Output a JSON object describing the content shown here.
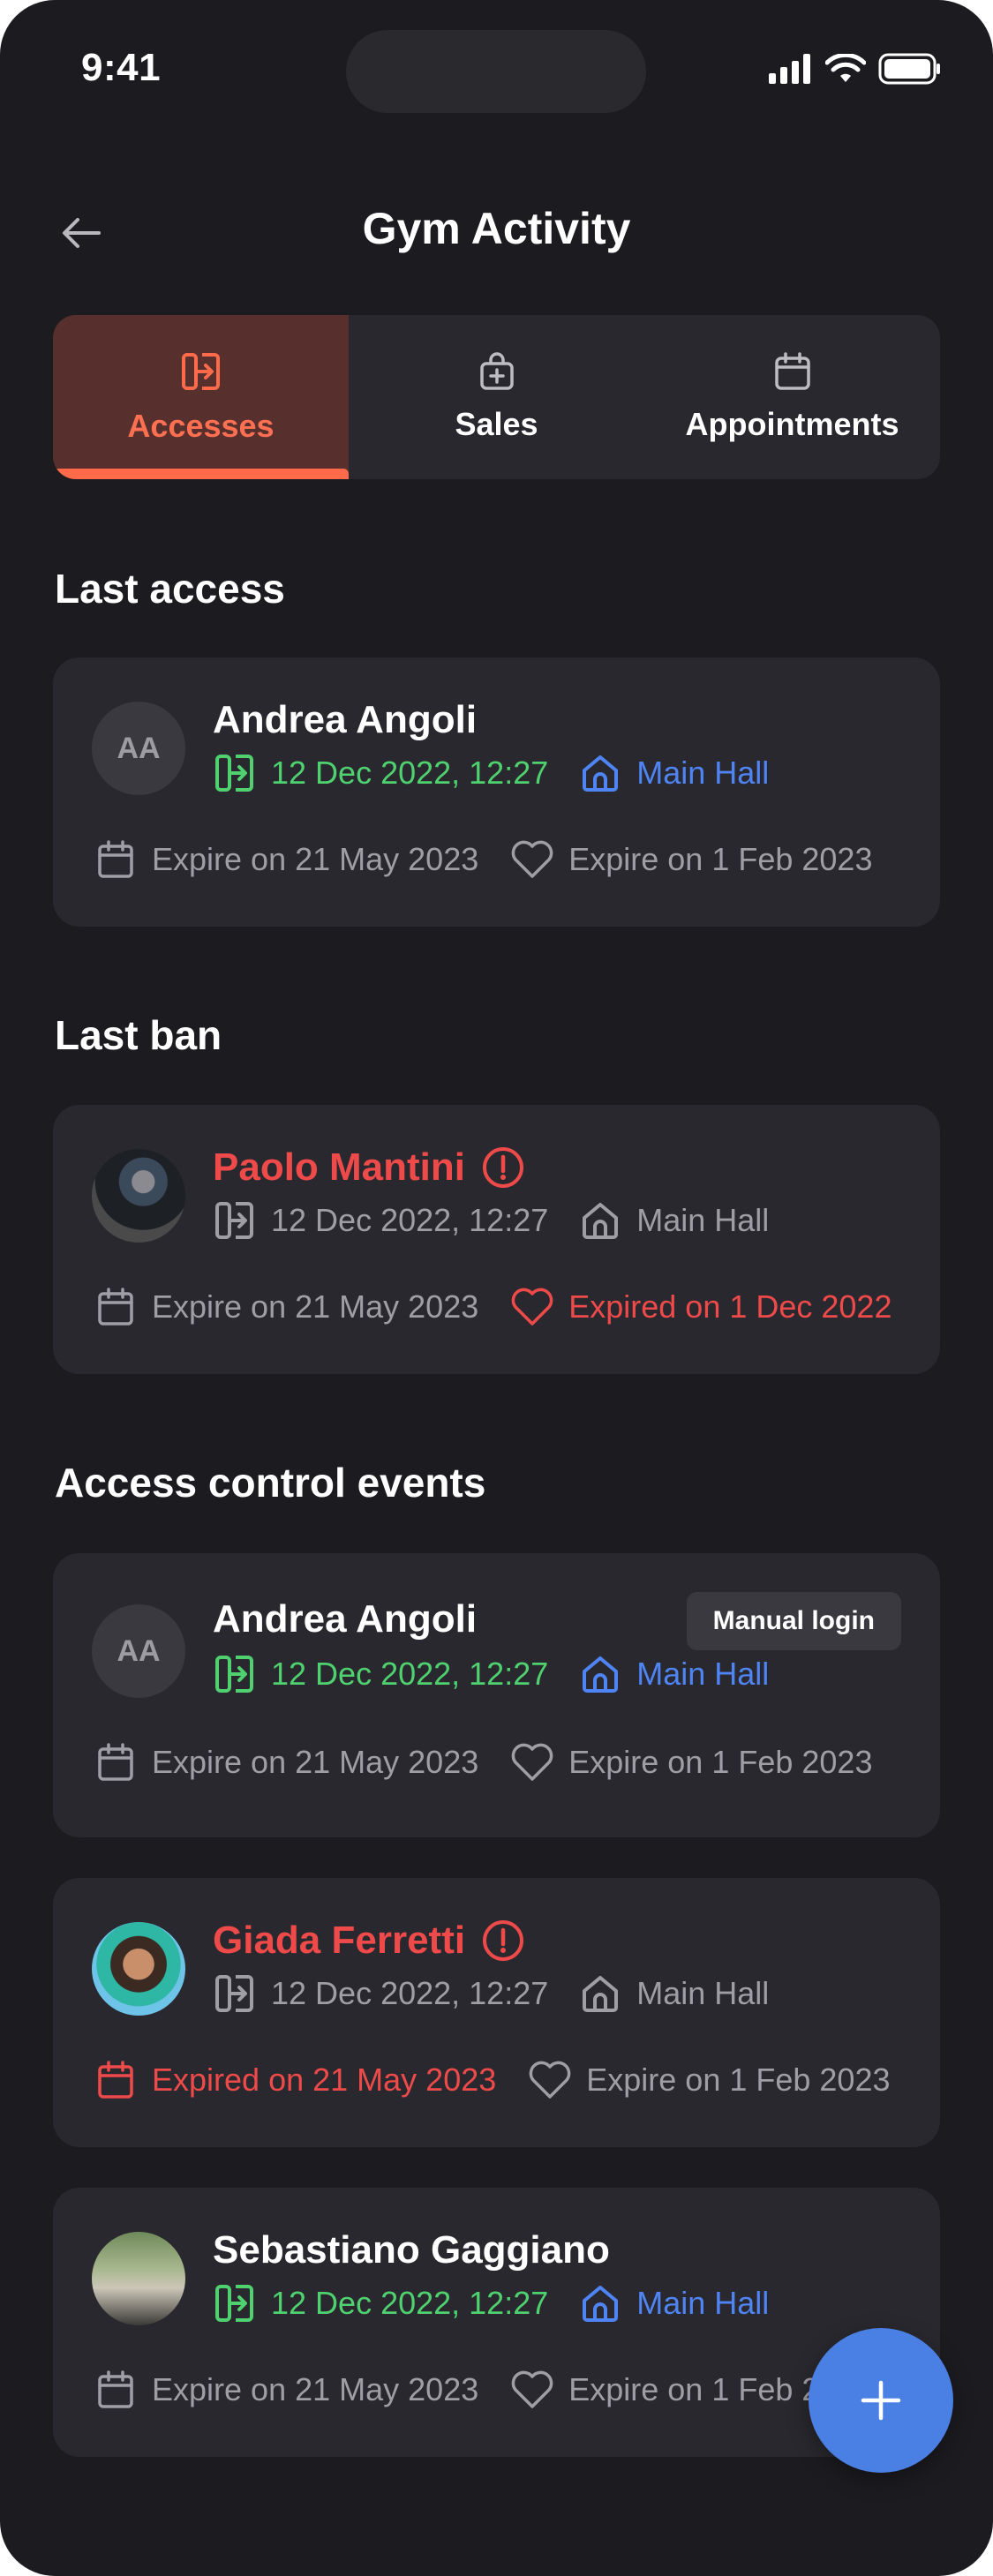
{
  "status_bar": {
    "time": "9:41"
  },
  "header": {
    "title": "Gym Activity",
    "back_icon": "arrow-left-icon"
  },
  "tabs": [
    {
      "label": "Accesses",
      "icon": "access-door-icon",
      "active": true
    },
    {
      "label": "Sales",
      "icon": "shopping-bag-plus-icon",
      "active": false
    },
    {
      "label": "Appointments",
      "icon": "calendar-icon",
      "active": false
    }
  ],
  "sections": {
    "last_access": "Last access",
    "last_ban": "Last ban",
    "events": "Access control events"
  },
  "last_access": {
    "initials": "AA",
    "name": "Andrea Angoli",
    "datetime": "12 Dec 2022, 12:27",
    "location": "Main Hall",
    "expire_1": "Expire on 21 May 2023",
    "expire_2": "Expire on 1 Feb 2023"
  },
  "last_ban": {
    "name": "Paolo Mantini",
    "datetime": "12 Dec 2022, 12:27",
    "location": "Main Hall",
    "expire_1": "Expire on 21 May 2023",
    "expire_2": "Expired on 1 Dec 2022"
  },
  "events": [
    {
      "initials": "AA",
      "name": "Andrea Angoli",
      "badge": "Manual login",
      "datetime": "12 Dec 2022, 12:27",
      "location": "Main Hall",
      "expire_1": "Expire on 21 May 2023",
      "expire_2": "Expire on 1 Feb 2023"
    },
    {
      "name": "Giada Ferretti",
      "datetime": "12 Dec 2022, 12:27",
      "location": "Main Hall",
      "expire_1": "Expired on 21 May 2023",
      "expire_2": "Expire on 1 Feb 2023"
    },
    {
      "name": "Sebastiano Gaggiano",
      "datetime": "12 Dec 2022, 12:27",
      "location": "Main Hall",
      "expire_1": "Expire on 21 May 2023",
      "expire_2": "Expire on 1 Feb 2023"
    }
  ],
  "fab": {
    "icon": "plus-icon"
  },
  "colors": {
    "background": "#1c1b20",
    "card": "#29282e",
    "accent": "#ff6a4b",
    "green": "#4fd16f",
    "blue": "#4f84f4",
    "red": "#ef4a4a",
    "fab": "#4a7fe3"
  }
}
